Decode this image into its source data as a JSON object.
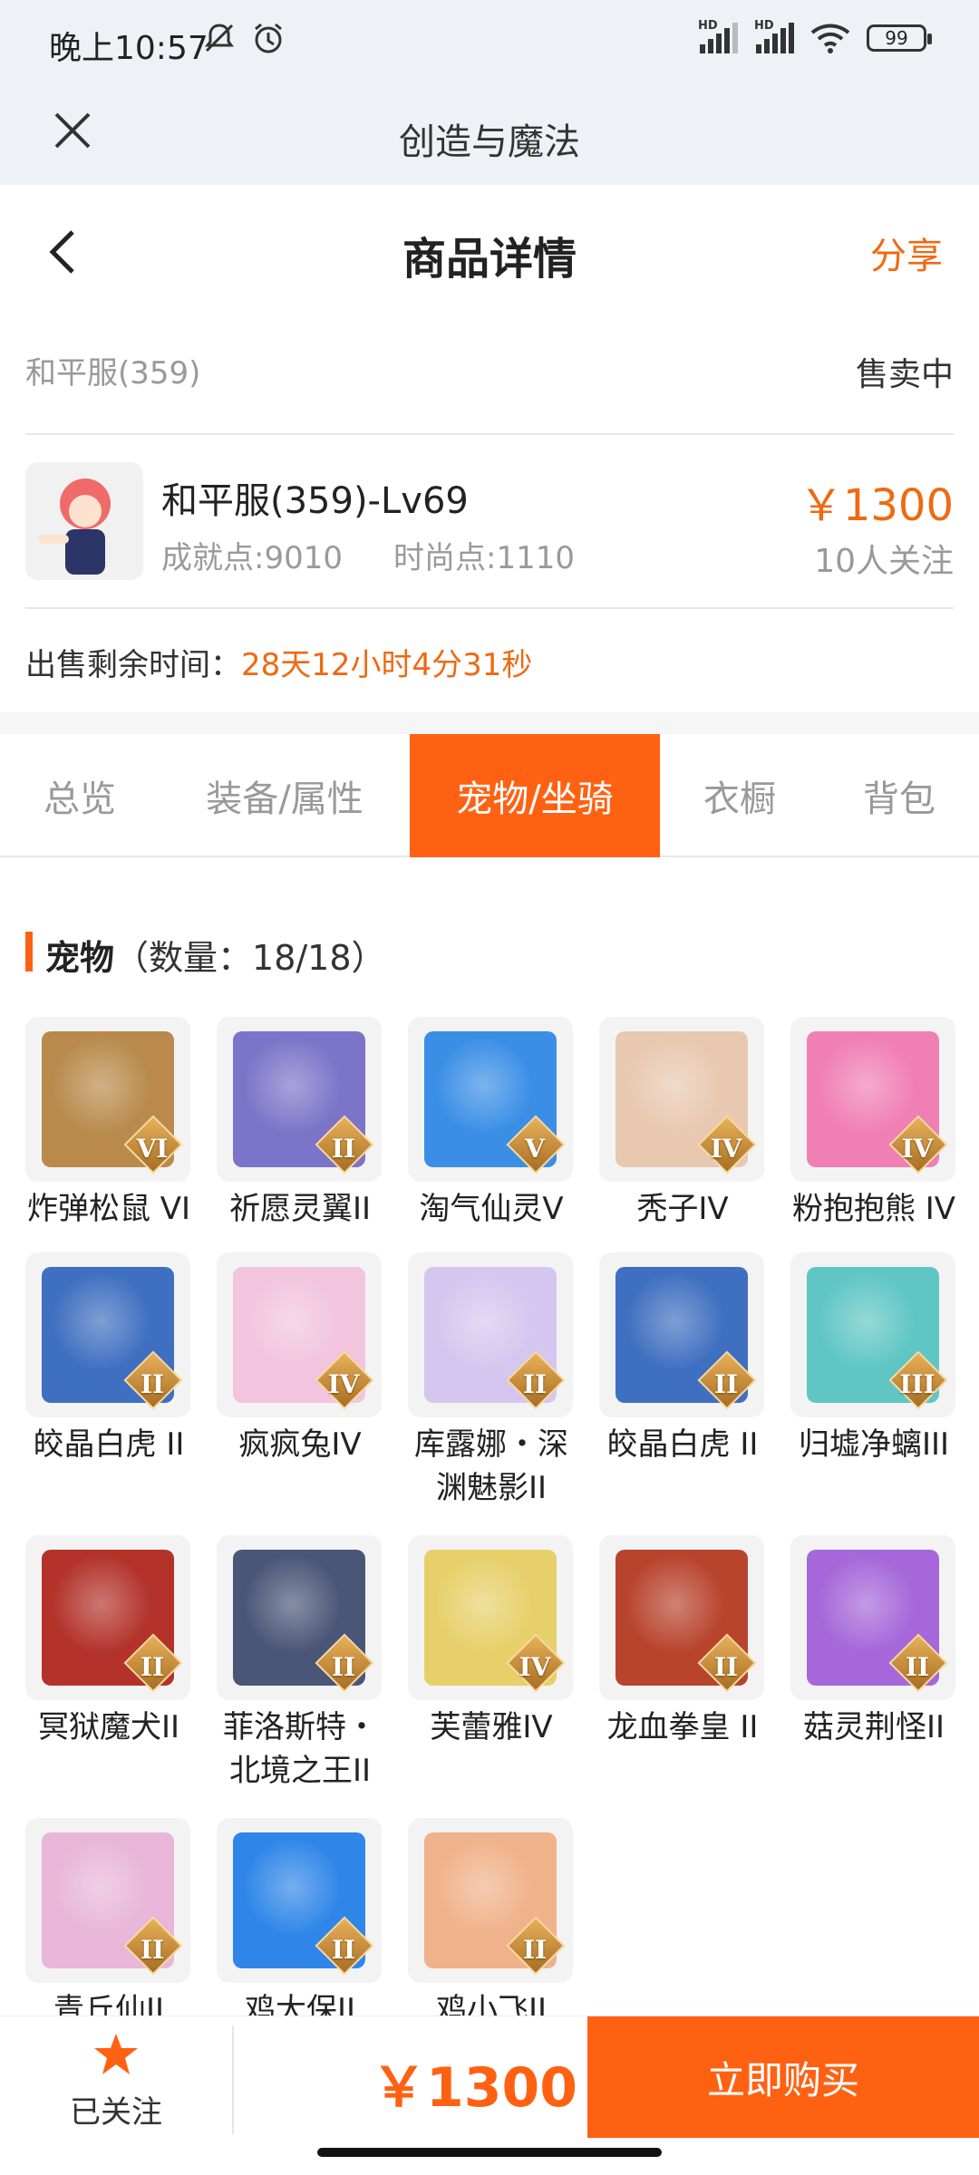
{
  "status_bar": {
    "time": "晚上10:57",
    "hd1": "HD",
    "hd2": "HD",
    "battery": "99"
  },
  "app_bar": {
    "title": "创造与魔法"
  },
  "detail_header": {
    "title": "商品详情",
    "share_label": "分享"
  },
  "server": {
    "name": "和平服(359)",
    "status": "售卖中"
  },
  "item": {
    "name": "和平服(359)-Lv69",
    "achievement": "成就点:9010",
    "fashion": "时尚点:1110",
    "price": "￥1300",
    "followers": "10人关注"
  },
  "remaining": {
    "label": "出售剩余时间：",
    "value": "28天12小时4分31秒"
  },
  "tabs": [
    {
      "label": "总览",
      "active": false
    },
    {
      "label": "装备/属性",
      "active": false
    },
    {
      "label": "宠物/坐骑",
      "active": true
    },
    {
      "label": "衣橱",
      "active": false
    },
    {
      "label": "背包",
      "active": false
    }
  ],
  "section": {
    "title": "宠物",
    "count": "（数量：18/18）"
  },
  "pets": [
    {
      "name": "炸弹松鼠 VI",
      "rank": "VI",
      "color": "#b98a4c"
    },
    {
      "name": "祈愿灵翼II",
      "rank": "II",
      "color": "#7c74c8"
    },
    {
      "name": "淘气仙灵V",
      "rank": "V",
      "color": "#3a8ee6"
    },
    {
      "name": "秃子IV",
      "rank": "IV",
      "color": "#e8c8b0"
    },
    {
      "name": "粉抱抱熊 IV",
      "rank": "IV",
      "color": "#f07fb4"
    },
    {
      "name": "皎晶白虎 II",
      "rank": "II",
      "color": "#3f6fc0"
    },
    {
      "name": "疯疯兔IV",
      "rank": "IV",
      "color": "#f2c4dd"
    },
    {
      "name": "库露娜・深渊魅影II",
      "rank": "II",
      "color": "#d5c6ef"
    },
    {
      "name": "皎晶白虎 II",
      "rank": "II",
      "color": "#3f6fc0"
    },
    {
      "name": "归墟净螭III",
      "rank": "III",
      "color": "#5fc6c4"
    },
    {
      "name": "冥狱魔犬II",
      "rank": "II",
      "color": "#b3332b"
    },
    {
      "name": "菲洛斯特・北境之王II",
      "rank": "II",
      "color": "#4a5677"
    },
    {
      "name": "芙蕾雅IV",
      "rank": "IV",
      "color": "#e7d06a"
    },
    {
      "name": "龙血拳皇 II",
      "rank": "II",
      "color": "#b8442e"
    },
    {
      "name": "菇灵荆怪II",
      "rank": "II",
      "color": "#a567d9"
    },
    {
      "name": "青丘仙II",
      "rank": "II",
      "color": "#e8b6d8"
    },
    {
      "name": "鸡大保II",
      "rank": "II",
      "color": "#2f86e8"
    },
    {
      "name": "鸡小飞II",
      "rank": "II",
      "color": "#f0b28a"
    }
  ],
  "bottom": {
    "follow_label": "已关注",
    "price": "￥1300",
    "buy_label": "立即购买"
  },
  "colors": {
    "accent": "#ff6112",
    "price_text": "#ee6a12",
    "status_bg": "#eef2f6"
  }
}
